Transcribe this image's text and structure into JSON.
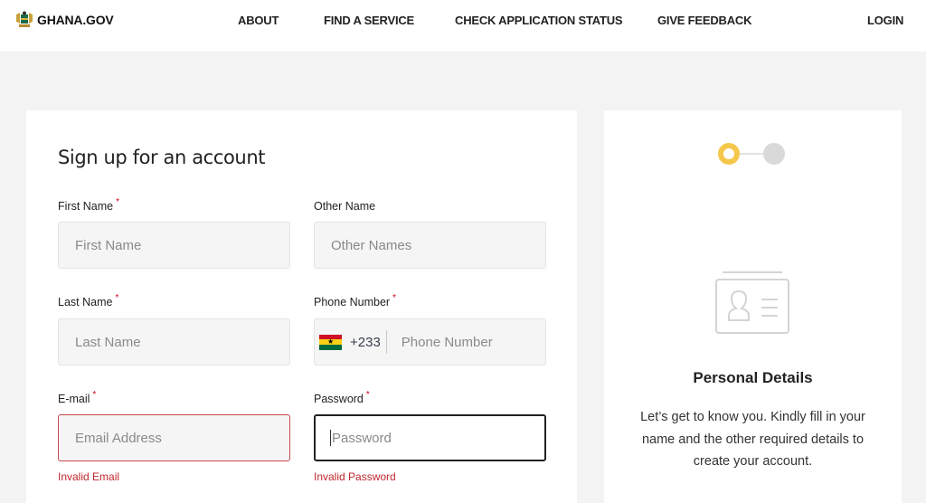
{
  "header": {
    "logo_text": "GHANA.GOV",
    "nav": [
      {
        "label": "ABOUT"
      },
      {
        "label": "FIND A SERVICE"
      },
      {
        "label": "CHECK APPLICATION STATUS"
      },
      {
        "label": "GIVE FEEDBACK"
      }
    ],
    "login_label": "LOGIN"
  },
  "form": {
    "title": "Sign up for an account",
    "required_mark": "*",
    "fields": {
      "first_name": {
        "label": "First Name",
        "placeholder": "First Name",
        "value": "",
        "required": true
      },
      "other_name": {
        "label": "Other Name",
        "placeholder": "Other Names",
        "value": "",
        "required": false
      },
      "last_name": {
        "label": "Last Name",
        "placeholder": "Last Name",
        "value": "",
        "required": true
      },
      "phone": {
        "label": "Phone Number",
        "placeholder": "Phone Number",
        "value": "",
        "required": true,
        "country_code": "+233",
        "country_flag": "ghana-flag"
      },
      "email": {
        "label": "E-mail",
        "placeholder": "Email Address",
        "value": "",
        "required": true,
        "error": "Invalid Email"
      },
      "password": {
        "label": "Password",
        "placeholder": "Password",
        "value": "",
        "required": true,
        "error": "Invalid Password",
        "focused": true
      }
    }
  },
  "sidebar": {
    "steps": [
      {
        "name": "personal-details",
        "state": "active"
      },
      {
        "name": "step-2",
        "state": "pending"
      }
    ],
    "icon": "id-card-icon",
    "title": "Personal Details",
    "description": "Let’s get to know you. Kindly fill in your name and the other required details to create your account."
  },
  "colors": {
    "page_bg": "#f3f3f3",
    "accent_yellow": "#f5c84c",
    "error_red": "#c0272d",
    "required_red": "#d0021b"
  }
}
